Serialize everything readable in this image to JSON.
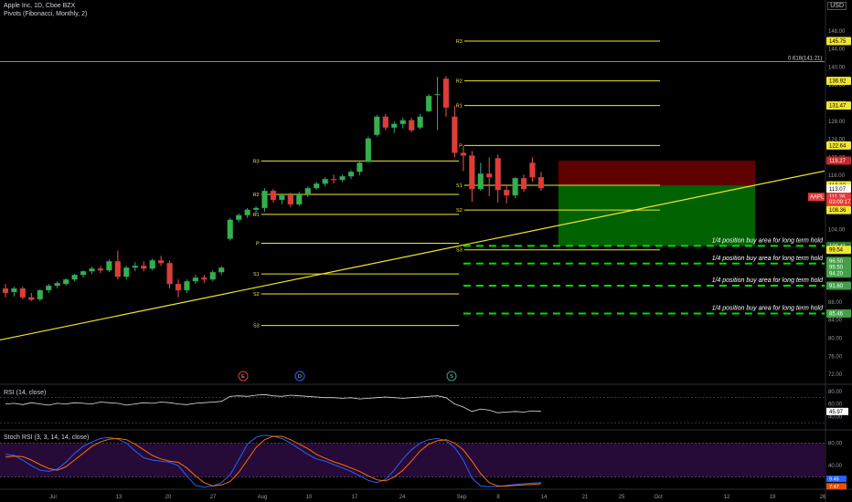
{
  "header": {
    "title": "Apple Inc, 1D, Cboe BZX",
    "pivots_label": "Pivots (Fibonacci, Monthly, 2)",
    "currency": "USD"
  },
  "chart_data": [
    {
      "type": "candlestick",
      "title": "Apple Inc, 1D, Cboe BZX",
      "ylim": [
        70,
        152
      ],
      "price_ticks": [
        148.0,
        144.0,
        140.0,
        136.0,
        132.0,
        128.0,
        124.0,
        120.0,
        116.0,
        112.0,
        108.0,
        104.0,
        100.0,
        96.0,
        92.0,
        88.0,
        84.0,
        80.0,
        76.0,
        72.0
      ],
      "x_ticks": [
        "Jul",
        "13",
        "20",
        "27",
        "Aug",
        "10",
        "17",
        "24",
        "Sep",
        "8",
        "14",
        "21",
        "25",
        "Oct",
        "12",
        "19",
        "26"
      ],
      "candles": [
        {
          "o": 91.0,
          "h": 92.0,
          "l": 89.0,
          "c": 90.0
        },
        {
          "o": 90.2,
          "h": 91.4,
          "l": 89.2,
          "c": 91.0
        },
        {
          "o": 91.0,
          "h": 91.4,
          "l": 88.6,
          "c": 89.0
        },
        {
          "o": 89.0,
          "h": 90.0,
          "l": 88.2,
          "c": 88.5
        },
        {
          "o": 88.6,
          "h": 90.8,
          "l": 88.2,
          "c": 90.6
        },
        {
          "o": 90.6,
          "h": 92.0,
          "l": 90.0,
          "c": 91.6
        },
        {
          "o": 91.6,
          "h": 92.6,
          "l": 91.0,
          "c": 92.2
        },
        {
          "o": 92.0,
          "h": 93.2,
          "l": 91.6,
          "c": 93.0
        },
        {
          "o": 93.0,
          "h": 94.2,
          "l": 92.6,
          "c": 94.0
        },
        {
          "o": 94.0,
          "h": 95.0,
          "l": 93.4,
          "c": 94.8
        },
        {
          "o": 94.8,
          "h": 95.8,
          "l": 94.2,
          "c": 95.4
        },
        {
          "o": 95.4,
          "h": 96.0,
          "l": 94.4,
          "c": 95.0
        },
        {
          "o": 95.0,
          "h": 97.4,
          "l": 94.6,
          "c": 97.0
        },
        {
          "o": 97.0,
          "h": 99.4,
          "l": 93.0,
          "c": 93.6
        },
        {
          "o": 93.6,
          "h": 96.0,
          "l": 93.0,
          "c": 95.6
        },
        {
          "o": 95.6,
          "h": 96.8,
          "l": 94.8,
          "c": 96.0
        },
        {
          "o": 96.0,
          "h": 97.0,
          "l": 94.8,
          "c": 95.4
        },
        {
          "o": 95.4,
          "h": 97.6,
          "l": 95.0,
          "c": 97.2
        },
        {
          "o": 97.2,
          "h": 98.2,
          "l": 96.0,
          "c": 96.6
        },
        {
          "o": 96.6,
          "h": 97.2,
          "l": 91.0,
          "c": 92.0
        },
        {
          "o": 92.0,
          "h": 93.0,
          "l": 89.0,
          "c": 90.6
        },
        {
          "o": 90.6,
          "h": 93.0,
          "l": 90.0,
          "c": 92.6
        },
        {
          "o": 92.6,
          "h": 94.0,
          "l": 92.0,
          "c": 93.4
        },
        {
          "o": 93.4,
          "h": 94.0,
          "l": 92.2,
          "c": 93.0
        },
        {
          "o": 93.0,
          "h": 95.0,
          "l": 92.6,
          "c": 94.6
        },
        {
          "o": 94.6,
          "h": 96.0,
          "l": 94.0,
          "c": 95.6
        },
        {
          "o": 102.0,
          "h": 106.6,
          "l": 101.6,
          "c": 106.2
        },
        {
          "o": 106.2,
          "h": 107.6,
          "l": 105.6,
          "c": 107.2
        },
        {
          "o": 107.2,
          "h": 108.8,
          "l": 106.6,
          "c": 108.4
        },
        {
          "o": 108.4,
          "h": 109.2,
          "l": 107.2,
          "c": 108.8
        },
        {
          "o": 108.8,
          "h": 113.2,
          "l": 108.0,
          "c": 112.6
        },
        {
          "o": 112.6,
          "h": 113.0,
          "l": 110.0,
          "c": 110.6
        },
        {
          "o": 110.6,
          "h": 112.0,
          "l": 109.6,
          "c": 111.6
        },
        {
          "o": 111.6,
          "h": 112.2,
          "l": 109.0,
          "c": 109.6
        },
        {
          "o": 109.6,
          "h": 112.4,
          "l": 109.2,
          "c": 112.0
        },
        {
          "o": 112.0,
          "h": 113.6,
          "l": 111.2,
          "c": 113.2
        },
        {
          "o": 113.2,
          "h": 114.6,
          "l": 112.8,
          "c": 114.2
        },
        {
          "o": 114.2,
          "h": 115.6,
          "l": 113.6,
          "c": 115.2
        },
        {
          "o": 115.2,
          "h": 116.2,
          "l": 114.2,
          "c": 115.0
        },
        {
          "o": 115.0,
          "h": 116.2,
          "l": 114.6,
          "c": 115.8
        },
        {
          "o": 115.8,
          "h": 117.2,
          "l": 115.2,
          "c": 116.8
        },
        {
          "o": 116.8,
          "h": 119.2,
          "l": 116.0,
          "c": 118.8
        },
        {
          "o": 119.0,
          "h": 124.6,
          "l": 118.8,
          "c": 124.2
        },
        {
          "o": 125.0,
          "h": 129.4,
          "l": 124.6,
          "c": 129.0
        },
        {
          "o": 129.0,
          "h": 129.6,
          "l": 126.0,
          "c": 126.6
        },
        {
          "o": 126.6,
          "h": 128.0,
          "l": 125.4,
          "c": 127.4
        },
        {
          "o": 127.4,
          "h": 128.8,
          "l": 126.4,
          "c": 128.2
        },
        {
          "o": 128.2,
          "h": 128.8,
          "l": 125.6,
          "c": 126.0
        },
        {
          "o": 126.6,
          "h": 129.6,
          "l": 126.2,
          "c": 129.0
        },
        {
          "o": 130.2,
          "h": 134.0,
          "l": 130.0,
          "c": 133.6
        },
        {
          "o": 134.0,
          "h": 137.8,
          "l": 126.0,
          "c": 134.0
        },
        {
          "o": 137.4,
          "h": 138.0,
          "l": 129.0,
          "c": 131.0
        },
        {
          "o": 129.0,
          "h": 131.4,
          "l": 120.0,
          "c": 121.0
        },
        {
          "o": 121.0,
          "h": 122.6,
          "l": 117.0,
          "c": 120.4
        },
        {
          "o": 120.4,
          "h": 121.4,
          "l": 110.2,
          "c": 113.0
        },
        {
          "o": 113.0,
          "h": 118.8,
          "l": 112.6,
          "c": 116.4
        },
        {
          "o": 116.4,
          "h": 120.0,
          "l": 111.4,
          "c": 115.6
        },
        {
          "o": 119.8,
          "h": 120.6,
          "l": 110.0,
          "c": 112.8
        },
        {
          "o": 112.8,
          "h": 113.6,
          "l": 109.8,
          "c": 111.6
        },
        {
          "o": 111.6,
          "h": 115.6,
          "l": 111.0,
          "c": 115.4
        },
        {
          "o": 115.4,
          "h": 116.2,
          "l": 112.4,
          "c": 113.0
        },
        {
          "o": 118.8,
          "h": 120.0,
          "l": 114.6,
          "c": 115.6
        },
        {
          "o": 115.6,
          "h": 116.8,
          "l": 112.6,
          "c": 113.2
        }
      ],
      "pivots": [
        {
          "name": "Jul",
          "labels": [
            "R1",
            "S1",
            "S2",
            "S3"
          ],
          "levels": [
            null,
            null,
            null,
            null
          ]
        },
        {
          "name": "Aug",
          "levels": [
            {
              "label": "R3",
              "value": 119.2
            },
            {
              "label": "R2",
              "value": 111.8
            },
            {
              "label": "R1",
              "value": 107.4
            },
            {
              "label": "P",
              "value": 101.0
            },
            {
              "label": "S1",
              "value": 94.2
            },
            {
              "label": "S2",
              "value": 89.8
            },
            {
              "label": "S3",
              "value": 82.8
            }
          ]
        },
        {
          "name": "Sep",
          "levels": [
            {
              "label": "R3",
              "value": 145.75
            },
            {
              "label": "R2",
              "value": 136.92
            },
            {
              "label": "R1",
              "value": 131.47
            },
            {
              "label": "P",
              "value": 122.64
            },
            {
              "label": "S1",
              "value": 113.82
            },
            {
              "label": "S2",
              "value": 108.36
            },
            {
              "label": "S3",
              "value": 99.54
            }
          ]
        }
      ],
      "fib_label": "0.618(141.21)",
      "fib_value": 141.21,
      "trendline": {
        "from": 79.6,
        "to": 117.0
      },
      "buy_zones": [
        {
          "label": "1/4 position buy area for long term hold",
          "value": 100.41
        },
        {
          "label": "1/4 position buy area for long term hold",
          "value": 96.5
        },
        {
          "label": "1/4 position buy area for long term hold",
          "value": 91.6
        },
        {
          "label": "1/4 position buy area for long term hold",
          "value": 85.46
        }
      ],
      "position": {
        "stop": 119.27,
        "entry": 113.82,
        "target": 100.41
      },
      "price_labels": [
        {
          "text": "145.75",
          "value": 145.75,
          "bg": "#f2e62e",
          "fg": "#000"
        },
        {
          "text": "136.92",
          "value": 136.92,
          "bg": "#f2e62e",
          "fg": "#000"
        },
        {
          "text": "131.47",
          "value": 131.47,
          "bg": "#f2e62e",
          "fg": "#000"
        },
        {
          "text": "122.64",
          "value": 122.64,
          "bg": "#f2e62e",
          "fg": "#000"
        },
        {
          "text": "119.27",
          "value": 119.27,
          "bg": "#c62828",
          "fg": "#fff"
        },
        {
          "text": "113.82",
          "value": 113.82,
          "bg": "#f2e62e",
          "fg": "#000"
        },
        {
          "text": "113.07",
          "value": 113.07,
          "bg": "#fff",
          "fg": "#000"
        },
        {
          "text": "111.26",
          "value": 111.26,
          "bg": "#e53935",
          "fg": "#fff"
        },
        {
          "text": "03:09:17",
          "value": 110.2,
          "bg": "#e53935",
          "fg": "#fff"
        },
        {
          "text": "108.36",
          "value": 108.36,
          "bg": "#f2e62e",
          "fg": "#000"
        },
        {
          "text": "100.41",
          "value": 100.41,
          "bg": "#2e7d32",
          "fg": "#fff"
        },
        {
          "text": "99.54",
          "value": 99.54,
          "bg": "#f2e62e",
          "fg": "#000"
        },
        {
          "text": "96.50",
          "value": 97.1,
          "bg": "#43a047",
          "fg": "#fff"
        },
        {
          "text": "95.50",
          "value": 95.8,
          "bg": "#43a047",
          "fg": "#fff"
        },
        {
          "text": "94.20",
          "value": 94.3,
          "bg": "#43a047",
          "fg": "#fff"
        },
        {
          "text": "91.60",
          "value": 91.6,
          "bg": "#43a047",
          "fg": "#fff"
        },
        {
          "text": "85.46",
          "value": 85.46,
          "bg": "#43a047",
          "fg": "#fff"
        }
      ],
      "symbol_tag": "AAPL",
      "events": [
        "E",
        "D",
        "S"
      ]
    },
    {
      "type": "line",
      "title": "RSI (14, close)",
      "ylim": [
        20,
        90
      ],
      "ticks": [
        "80.00",
        "60.00",
        "40.00"
      ],
      "last_value_label": "45.97",
      "values": [
        60,
        61,
        59,
        62,
        60,
        58,
        61,
        60,
        62,
        61,
        60,
        63,
        62,
        61,
        58,
        60,
        62,
        61,
        63,
        62,
        60,
        59,
        61,
        62,
        63,
        64,
        72,
        73,
        72,
        74,
        75,
        73,
        72,
        74,
        73,
        72,
        71,
        70,
        70,
        69,
        70,
        68,
        69,
        70,
        71,
        70,
        69,
        70,
        71,
        72,
        73,
        70,
        60,
        55,
        48,
        52,
        50,
        46,
        47,
        48,
        47,
        49,
        48
      ]
    },
    {
      "type": "line",
      "title": "Stoch RSI (3, 3, 14, 14, close)",
      "ylim": [
        0,
        100
      ],
      "ticks": [
        "80.00",
        "40.00"
      ],
      "last_value_labels": [
        "9.45",
        "7.47"
      ],
      "series": [
        {
          "name": "K",
          "values": [
            60,
            58,
            50,
            40,
            32,
            30,
            34,
            46,
            62,
            74,
            82,
            88,
            90,
            87,
            80,
            66,
            54,
            50,
            48,
            46,
            40,
            22,
            5,
            2,
            4,
            10,
            24,
            50,
            78,
            90,
            94,
            92,
            88,
            80,
            70,
            60,
            52,
            48,
            42,
            36,
            30,
            22,
            14,
            10,
            16,
            32,
            52,
            68,
            80,
            86,
            88,
            84,
            72,
            50,
            18,
            4,
            3,
            3,
            5,
            7,
            8,
            9,
            10
          ]
        },
        {
          "name": "D",
          "values": [
            55,
            57,
            56,
            50,
            42,
            35,
            32,
            38,
            50,
            62,
            74,
            82,
            87,
            88,
            86,
            78,
            68,
            58,
            52,
            48,
            46,
            36,
            22,
            10,
            4,
            6,
            12,
            28,
            50,
            72,
            86,
            92,
            92,
            86,
            78,
            70,
            60,
            53,
            47,
            42,
            36,
            30,
            22,
            15,
            13,
            20,
            32,
            48,
            66,
            78,
            84,
            86,
            80,
            68,
            48,
            26,
            10,
            4,
            4,
            5,
            6,
            7,
            8
          ]
        }
      ]
    }
  ]
}
